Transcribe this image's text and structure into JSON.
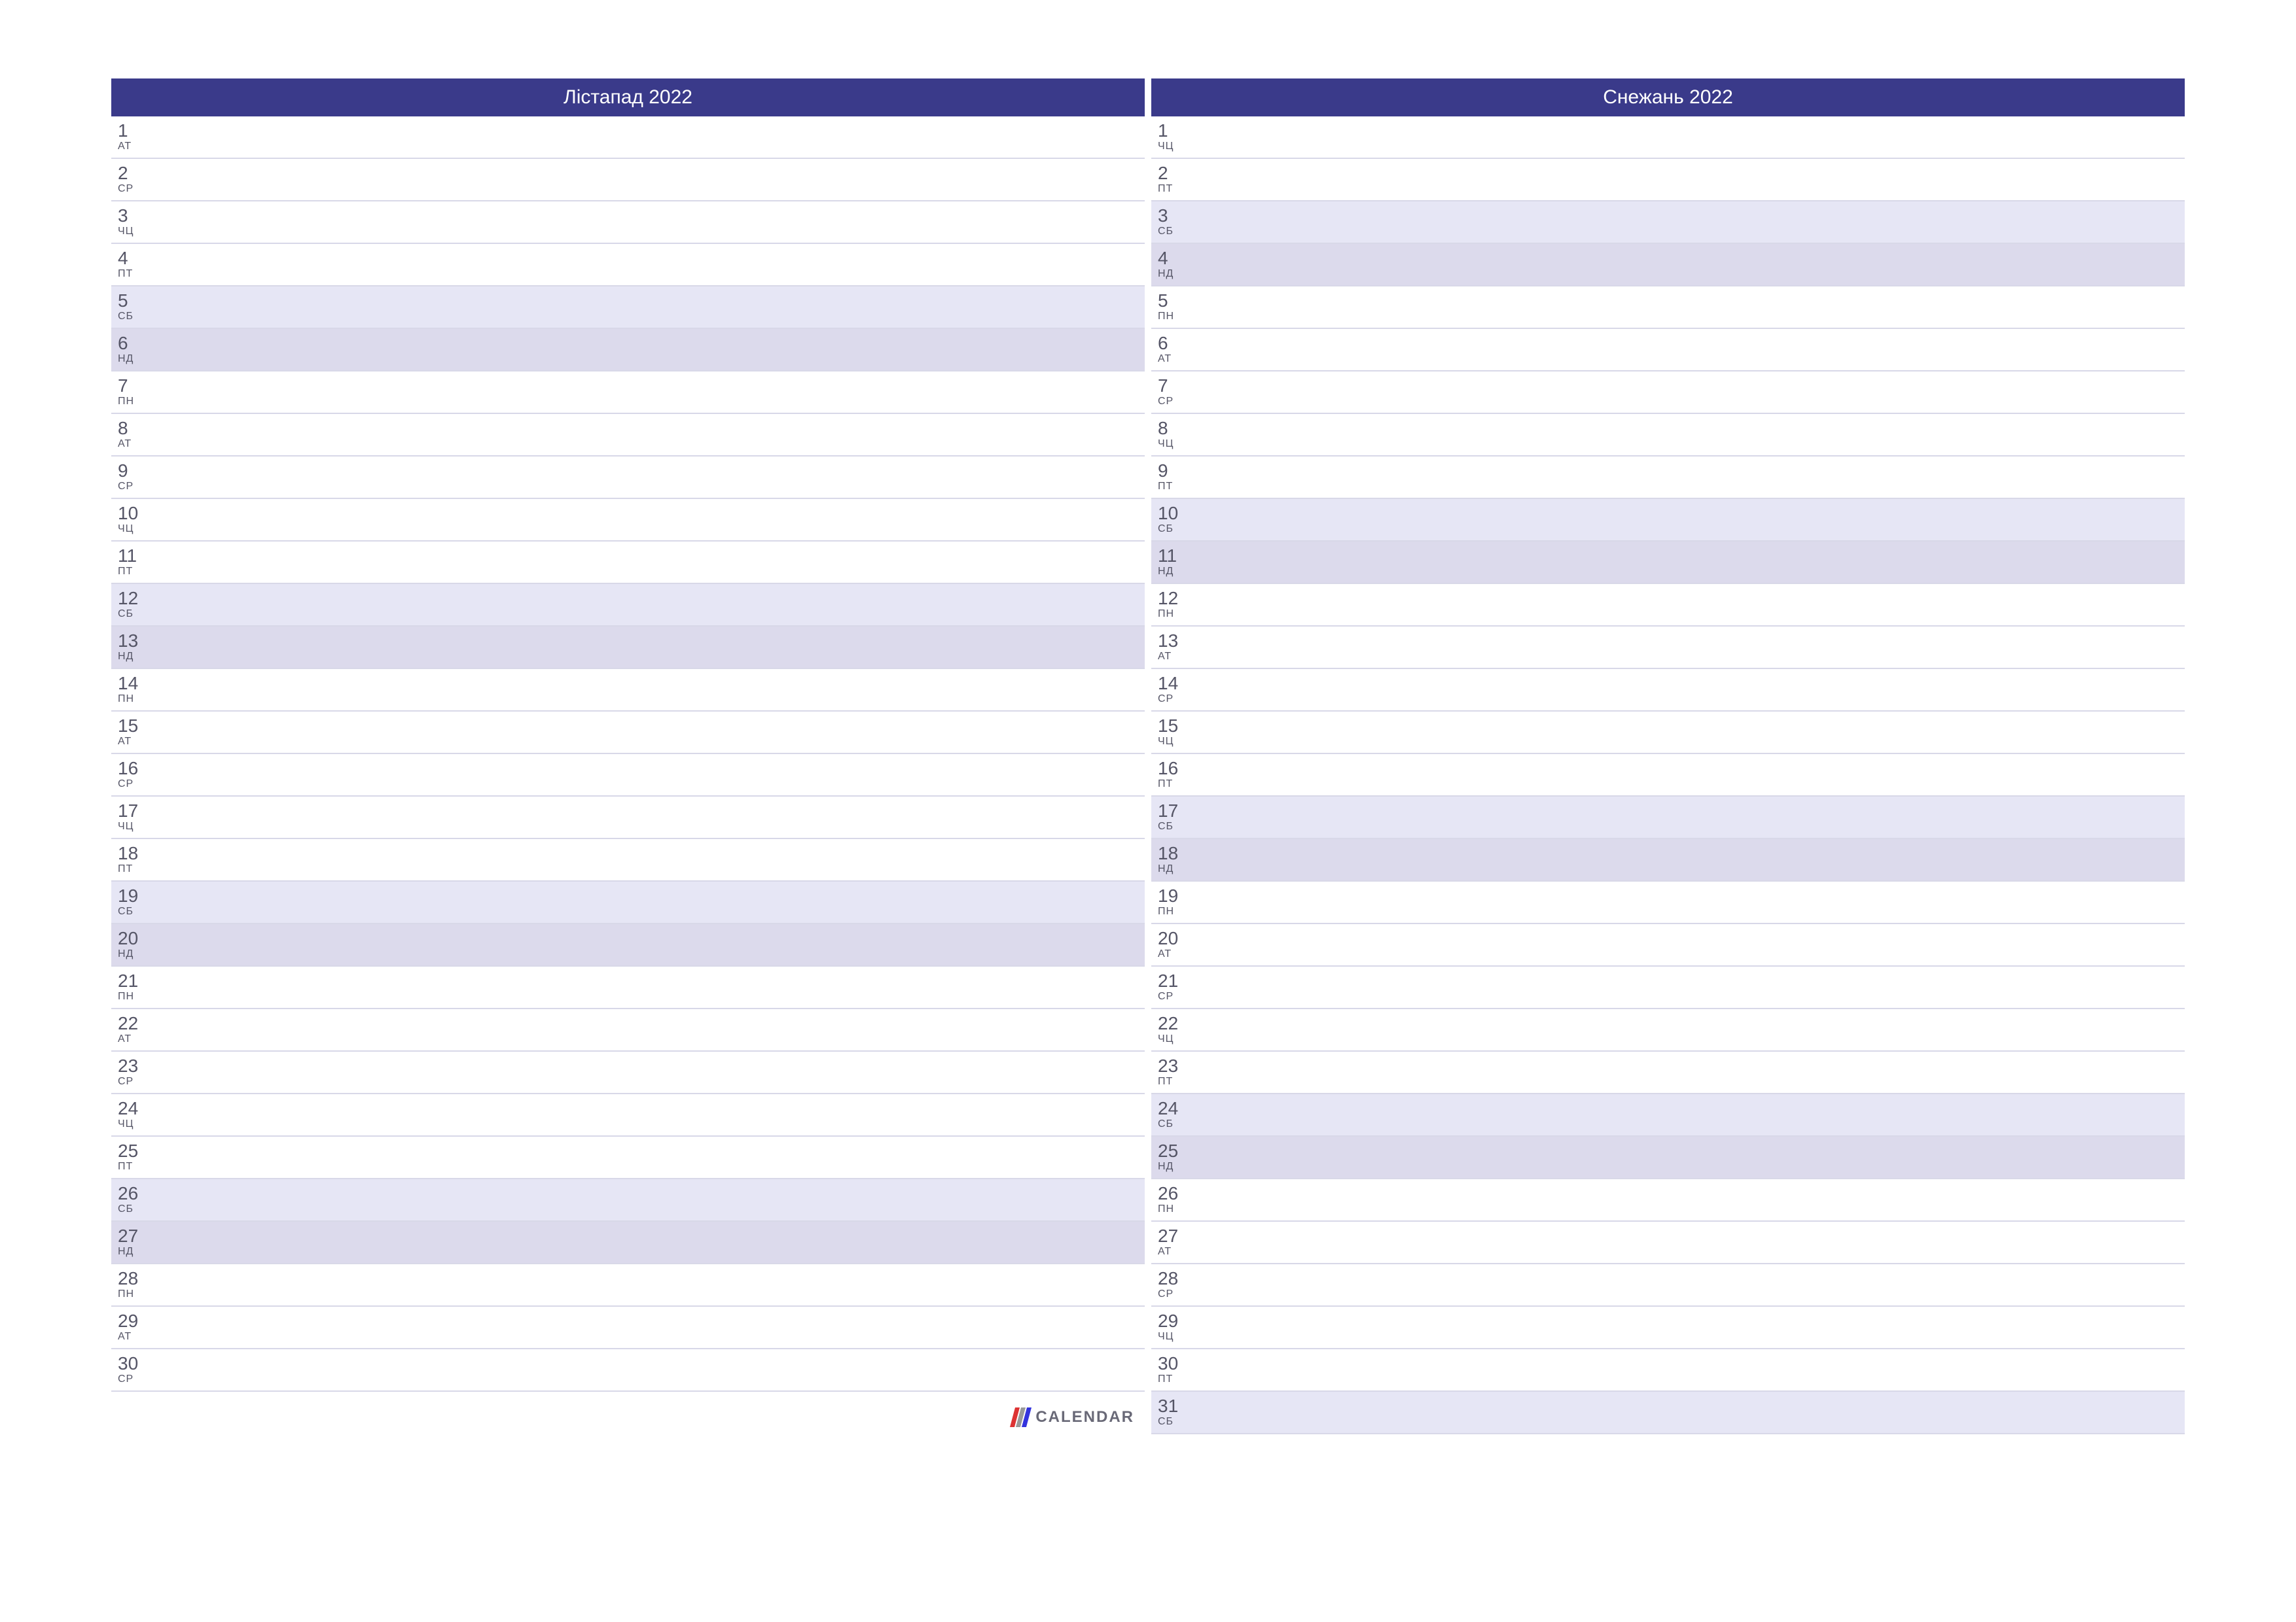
{
  "logo_text": "CALENDAR",
  "months": [
    {
      "title": "Лістапад 2022",
      "days": [
        {
          "num": "1",
          "name": "АТ",
          "type": "weekday"
        },
        {
          "num": "2",
          "name": "СР",
          "type": "weekday"
        },
        {
          "num": "3",
          "name": "ЧЦ",
          "type": "weekday"
        },
        {
          "num": "4",
          "name": "ПТ",
          "type": "weekday"
        },
        {
          "num": "5",
          "name": "СБ",
          "type": "saturday"
        },
        {
          "num": "6",
          "name": "НД",
          "type": "sunday"
        },
        {
          "num": "7",
          "name": "ПН",
          "type": "weekday"
        },
        {
          "num": "8",
          "name": "АТ",
          "type": "weekday"
        },
        {
          "num": "9",
          "name": "СР",
          "type": "weekday"
        },
        {
          "num": "10",
          "name": "ЧЦ",
          "type": "weekday"
        },
        {
          "num": "11",
          "name": "ПТ",
          "type": "weekday"
        },
        {
          "num": "12",
          "name": "СБ",
          "type": "saturday"
        },
        {
          "num": "13",
          "name": "НД",
          "type": "sunday"
        },
        {
          "num": "14",
          "name": "ПН",
          "type": "weekday"
        },
        {
          "num": "15",
          "name": "АТ",
          "type": "weekday"
        },
        {
          "num": "16",
          "name": "СР",
          "type": "weekday"
        },
        {
          "num": "17",
          "name": "ЧЦ",
          "type": "weekday"
        },
        {
          "num": "18",
          "name": "ПТ",
          "type": "weekday"
        },
        {
          "num": "19",
          "name": "СБ",
          "type": "saturday"
        },
        {
          "num": "20",
          "name": "НД",
          "type": "sunday"
        },
        {
          "num": "21",
          "name": "ПН",
          "type": "weekday"
        },
        {
          "num": "22",
          "name": "АТ",
          "type": "weekday"
        },
        {
          "num": "23",
          "name": "СР",
          "type": "weekday"
        },
        {
          "num": "24",
          "name": "ЧЦ",
          "type": "weekday"
        },
        {
          "num": "25",
          "name": "ПТ",
          "type": "weekday"
        },
        {
          "num": "26",
          "name": "СБ",
          "type": "saturday"
        },
        {
          "num": "27",
          "name": "НД",
          "type": "sunday"
        },
        {
          "num": "28",
          "name": "ПН",
          "type": "weekday"
        },
        {
          "num": "29",
          "name": "АТ",
          "type": "weekday"
        },
        {
          "num": "30",
          "name": "СР",
          "type": "weekday"
        }
      ]
    },
    {
      "title": "Снежань 2022",
      "days": [
        {
          "num": "1",
          "name": "ЧЦ",
          "type": "weekday"
        },
        {
          "num": "2",
          "name": "ПТ",
          "type": "weekday"
        },
        {
          "num": "3",
          "name": "СБ",
          "type": "saturday"
        },
        {
          "num": "4",
          "name": "НД",
          "type": "sunday"
        },
        {
          "num": "5",
          "name": "ПН",
          "type": "weekday"
        },
        {
          "num": "6",
          "name": "АТ",
          "type": "weekday"
        },
        {
          "num": "7",
          "name": "СР",
          "type": "weekday"
        },
        {
          "num": "8",
          "name": "ЧЦ",
          "type": "weekday"
        },
        {
          "num": "9",
          "name": "ПТ",
          "type": "weekday"
        },
        {
          "num": "10",
          "name": "СБ",
          "type": "saturday"
        },
        {
          "num": "11",
          "name": "НД",
          "type": "sunday"
        },
        {
          "num": "12",
          "name": "ПН",
          "type": "weekday"
        },
        {
          "num": "13",
          "name": "АТ",
          "type": "weekday"
        },
        {
          "num": "14",
          "name": "СР",
          "type": "weekday"
        },
        {
          "num": "15",
          "name": "ЧЦ",
          "type": "weekday"
        },
        {
          "num": "16",
          "name": "ПТ",
          "type": "weekday"
        },
        {
          "num": "17",
          "name": "СБ",
          "type": "saturday"
        },
        {
          "num": "18",
          "name": "НД",
          "type": "sunday"
        },
        {
          "num": "19",
          "name": "ПН",
          "type": "weekday"
        },
        {
          "num": "20",
          "name": "АТ",
          "type": "weekday"
        },
        {
          "num": "21",
          "name": "СР",
          "type": "weekday"
        },
        {
          "num": "22",
          "name": "ЧЦ",
          "type": "weekday"
        },
        {
          "num": "23",
          "name": "ПТ",
          "type": "weekday"
        },
        {
          "num": "24",
          "name": "СБ",
          "type": "saturday"
        },
        {
          "num": "25",
          "name": "НД",
          "type": "sunday"
        },
        {
          "num": "26",
          "name": "ПН",
          "type": "weekday"
        },
        {
          "num": "27",
          "name": "АТ",
          "type": "weekday"
        },
        {
          "num": "28",
          "name": "СР",
          "type": "weekday"
        },
        {
          "num": "29",
          "name": "ЧЦ",
          "type": "weekday"
        },
        {
          "num": "30",
          "name": "ПТ",
          "type": "weekday"
        },
        {
          "num": "31",
          "name": "СБ",
          "type": "saturday"
        }
      ]
    }
  ]
}
